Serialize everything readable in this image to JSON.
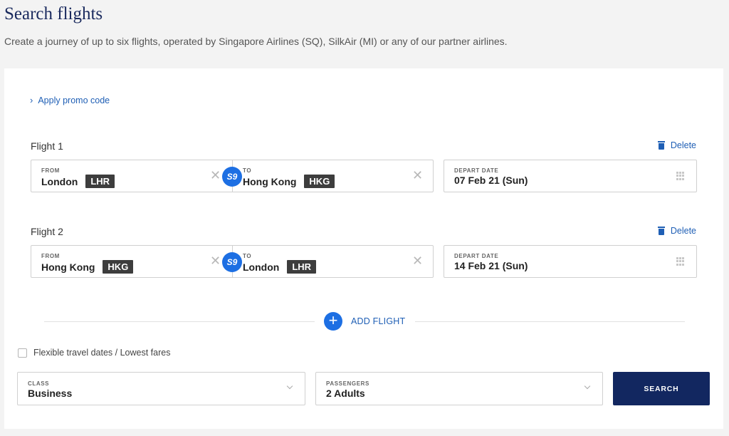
{
  "header": {
    "title": "Search flights",
    "subtitle": "Create a journey of up to six flights, operated by Singapore Airlines (SQ), SilkAir (MI) or any of our partner airlines."
  },
  "promo": {
    "label": "Apply promo code"
  },
  "flights": [
    {
      "label": "Flight 1",
      "delete_label": "Delete",
      "from_label": "FROM",
      "from_city": "London",
      "from_code": "LHR",
      "to_label": "TO",
      "to_city": "Hong Kong",
      "to_code": "HKG",
      "date_label": "DEPART DATE",
      "date_value": "07 Feb 21 (Sun)"
    },
    {
      "label": "Flight 2",
      "delete_label": "Delete",
      "from_label": "FROM",
      "from_city": "Hong Kong",
      "from_code": "HKG",
      "to_label": "TO",
      "to_city": "London",
      "to_code": "LHR",
      "date_label": "DEPART DATE",
      "date_value": "14 Feb 21 (Sun)"
    }
  ],
  "swap_icon_text": "S9",
  "add_flight": {
    "label": "ADD FLIGHT"
  },
  "flexible": {
    "label": "Flexible travel dates / Lowest fares",
    "checked": false
  },
  "class_select": {
    "label": "CLASS",
    "value": "Business"
  },
  "passengers_select": {
    "label": "PASSENGERS",
    "value": "2 Adults"
  },
  "search_button": {
    "label": "SEARCH"
  },
  "colors": {
    "accent": "#1d6fe3",
    "link": "#1f5fb5",
    "primary_button": "#122760",
    "title": "#1a2a5e"
  }
}
